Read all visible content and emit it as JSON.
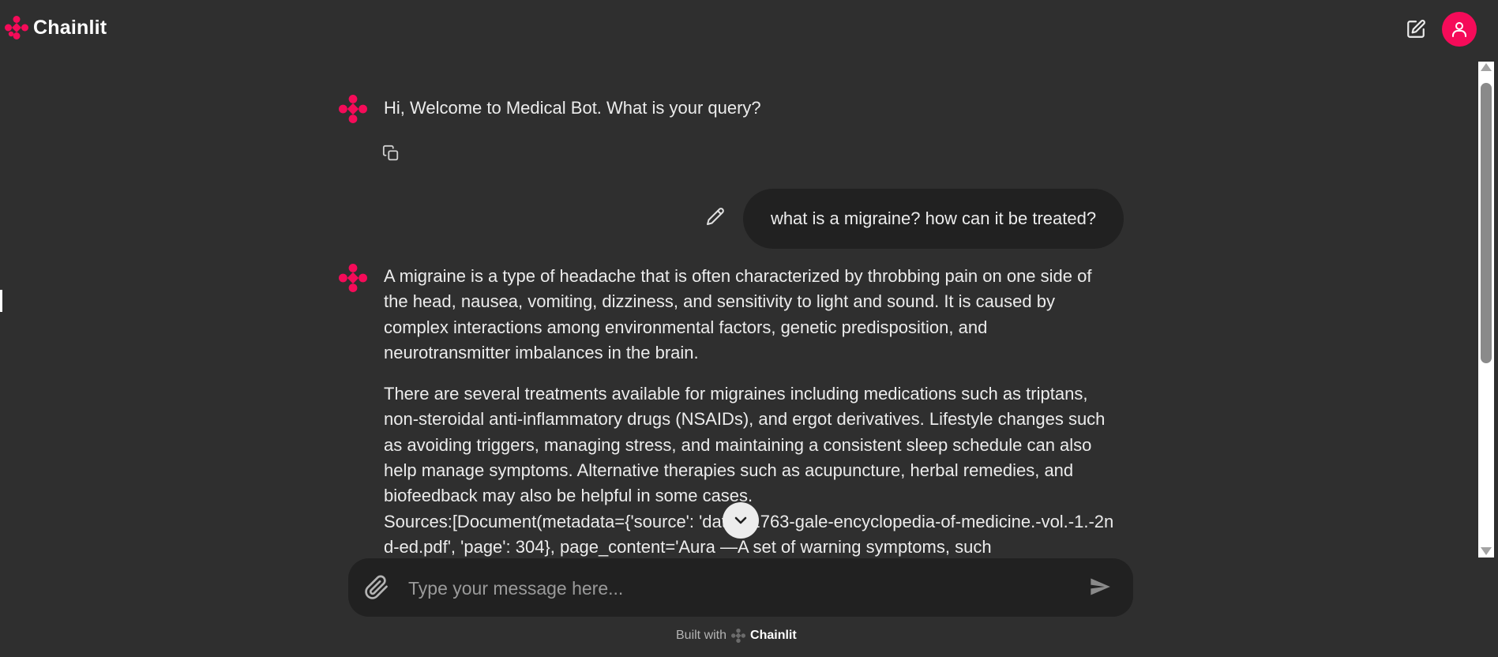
{
  "brand": {
    "name": "Chainlit",
    "accent_color": "#f50b59"
  },
  "header": {
    "new_chat_icon": "edit-square-icon",
    "user_icon": "user-icon"
  },
  "messages": [
    {
      "role": "assistant",
      "text": "Hi, Welcome to Medical Bot. What is your query?",
      "action_icon": "copy-icon"
    },
    {
      "role": "user",
      "text": "what is a migraine? how can it be treated?",
      "action_icon": "pencil-icon"
    },
    {
      "role": "assistant",
      "paragraphs": [
        "A migraine is a type of headache that is often characterized by throbbing pain on one side of the head, nausea, vomiting, dizziness, and sensitivity to light and sound. It is caused by complex interactions among environmental factors, genetic predisposition, and neurotransmitter imbalances in the brain.",
        "There are several treatments available for migraines including medications such as triptans, non-steroidal anti-inflammatory drugs (NSAIDs), and ergot derivatives. Lifestyle changes such as avoiding triggers, managing stress, and maintaining a consistent sleep schedule can also help manage symptoms. Alternative therapies such as acupuncture, herbal remedies, and biofeedback may also be helpful in some cases.",
        "Sources:[Document(metadata={'source': 'data\\71763-gale-encyclopedia-of-medicine.-vol.-1.-2nd-ed.pdf', 'page': 304}, page_content='Aura —A set of warning symptoms, such"
      ]
    }
  ],
  "composer": {
    "placeholder": "Type your message here...",
    "attach_icon": "paperclip-icon",
    "send_icon": "send-icon"
  },
  "footer": {
    "built_with": "Built with",
    "brand": "Chainlit"
  }
}
